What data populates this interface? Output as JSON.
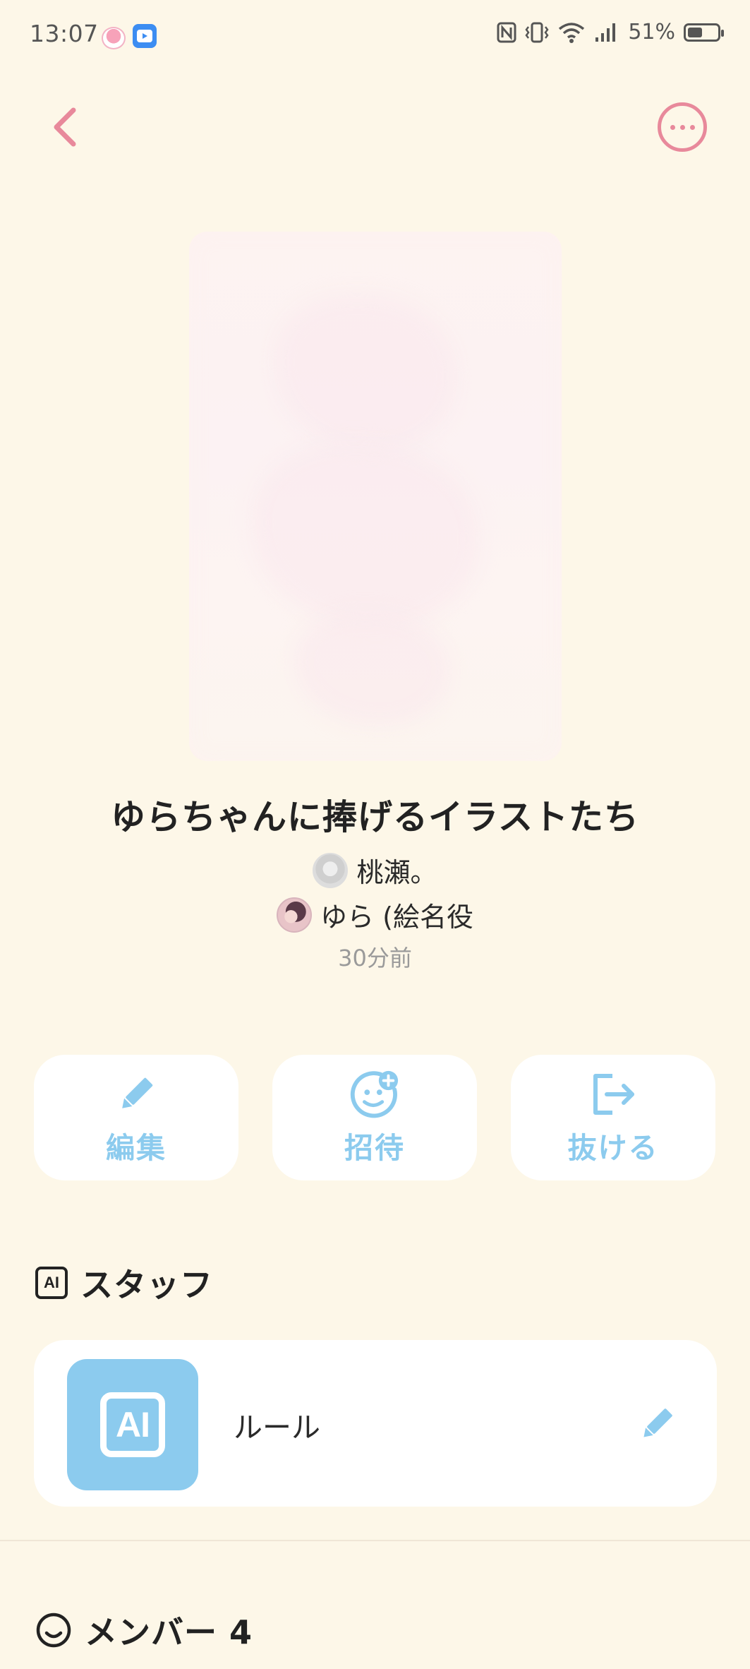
{
  "status_bar": {
    "time": "13:07",
    "battery_percent": "51%",
    "battery_level": 0.51,
    "icons": [
      "teacup-app-icon",
      "youtube-app-icon",
      "nfc-icon",
      "vibrate-icon",
      "wifi-icon",
      "signal-icon",
      "battery-icon"
    ]
  },
  "nav": {
    "back_icon": "chevron-left-icon",
    "more_icon": "more-horizontal-icon"
  },
  "album": {
    "title": "ゆらちゃんに捧げるイラストたち",
    "authors": [
      {
        "name": "桃瀬。"
      },
      {
        "name": "ゆら (絵名役"
      }
    ],
    "timestamp": "30分前"
  },
  "actions": [
    {
      "label": "編集",
      "icon": "pencil-icon"
    },
    {
      "label": "招待",
      "icon": "add-friend-icon"
    },
    {
      "label": "抜ける",
      "icon": "exit-icon"
    }
  ],
  "staff_section": {
    "title": "スタッフ",
    "icon": "ai-badge-icon",
    "badge_text": "AI",
    "items": [
      {
        "name": "ルール",
        "avatar_text": "AI",
        "edit_icon": "pencil-icon"
      }
    ]
  },
  "members_section": {
    "title": "メンバー 4",
    "icon": "smile-icon"
  },
  "colors": {
    "background": "#fdf7e8",
    "accent_pink": "#e8899b",
    "accent_blue": "#8ccbee",
    "card": "#ffffff"
  }
}
